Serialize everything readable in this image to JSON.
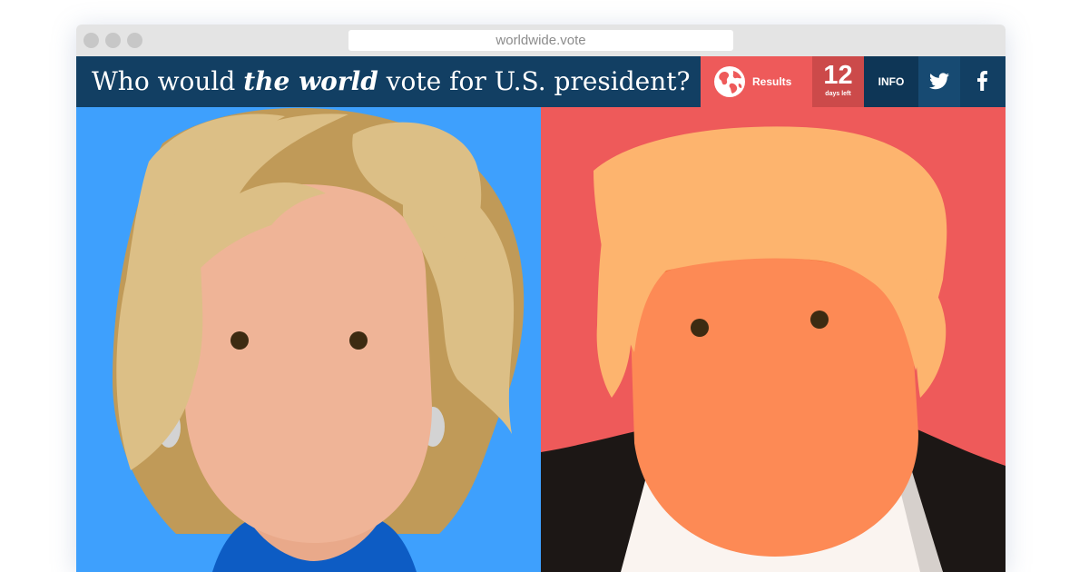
{
  "browser": {
    "url": "worldwide.vote"
  },
  "header": {
    "title_prefix": "Who would ",
    "title_emphasis": "the world",
    "title_suffix": " vote for U.S. president?",
    "results_label": "Results",
    "countdown_number": "12",
    "countdown_label": "days left",
    "info_label": "INFO"
  },
  "icons": {
    "results": "globe-icon",
    "twitter": "twitter-icon",
    "facebook": "facebook-icon"
  },
  "colors": {
    "header_bg": "#123f63",
    "results_bg": "#ee5a5a",
    "countdown_bg": "#cc4a4a",
    "left_panel_bg": "#3ea0fd",
    "right_panel_bg": "#ee5a5a"
  }
}
